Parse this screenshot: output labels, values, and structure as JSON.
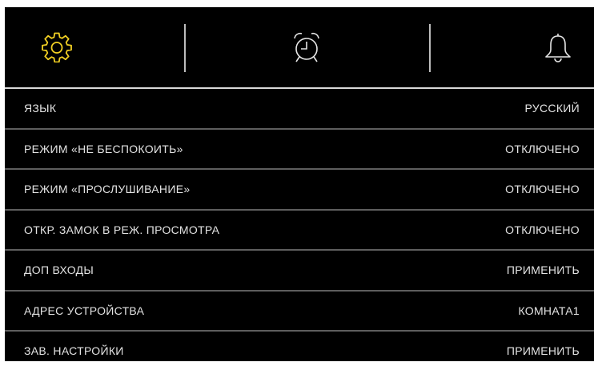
{
  "tabs": [
    {
      "icon": "gear-icon",
      "color": "#f2d023"
    },
    {
      "icon": "alarm-clock-icon",
      "color": "#e6e6e6"
    },
    {
      "icon": "bell-icon",
      "color": "#e6e6e6"
    }
  ],
  "settings": [
    {
      "label": "ЯЗЫК",
      "value": "РУССКИЙ"
    },
    {
      "label": "РЕЖИМ «НЕ БЕСПОКОИТЬ»",
      "value": "ОТКЛЮЧЕНО"
    },
    {
      "label": "РЕЖИМ «ПРОСЛУШИВАНИЕ»",
      "value": "ОТКЛЮЧЕНО"
    },
    {
      "label": "ОТКР. ЗАМОК В РЕЖ. ПРОСМОТРА",
      "value": "ОТКЛЮЧЕНО"
    },
    {
      "label": "ДОП ВХОДЫ",
      "value": "ПРИМЕНИТЬ"
    },
    {
      "label": "АДРЕС УСТРОЙСТВА",
      "value": "КОМНАТА1"
    },
    {
      "label": "ЗАВ. НАСТРОЙКИ",
      "value": "ПРИМЕНИТЬ"
    }
  ]
}
